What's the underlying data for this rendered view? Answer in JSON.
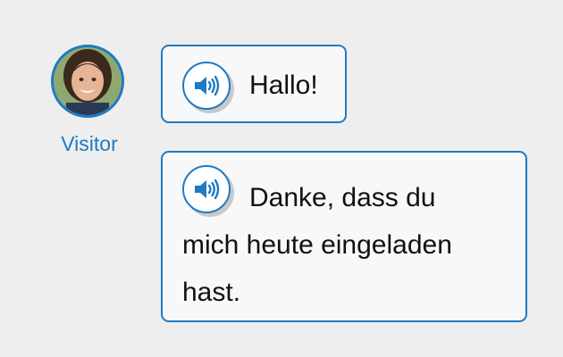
{
  "conversation": {
    "speaker": {
      "name": "Visitor",
      "avatar": "avatar-photo"
    },
    "messages": [
      {
        "text": "Hallo!",
        "icon": "speaker-icon"
      },
      {
        "text": "Danke, dass du mich heute eingeladen hast.",
        "icon": "speaker-icon"
      }
    ]
  },
  "colors": {
    "accent": "#1f7ac4",
    "bubble_bg": "#f8f8f8",
    "page_bg": "#eeeeee"
  }
}
